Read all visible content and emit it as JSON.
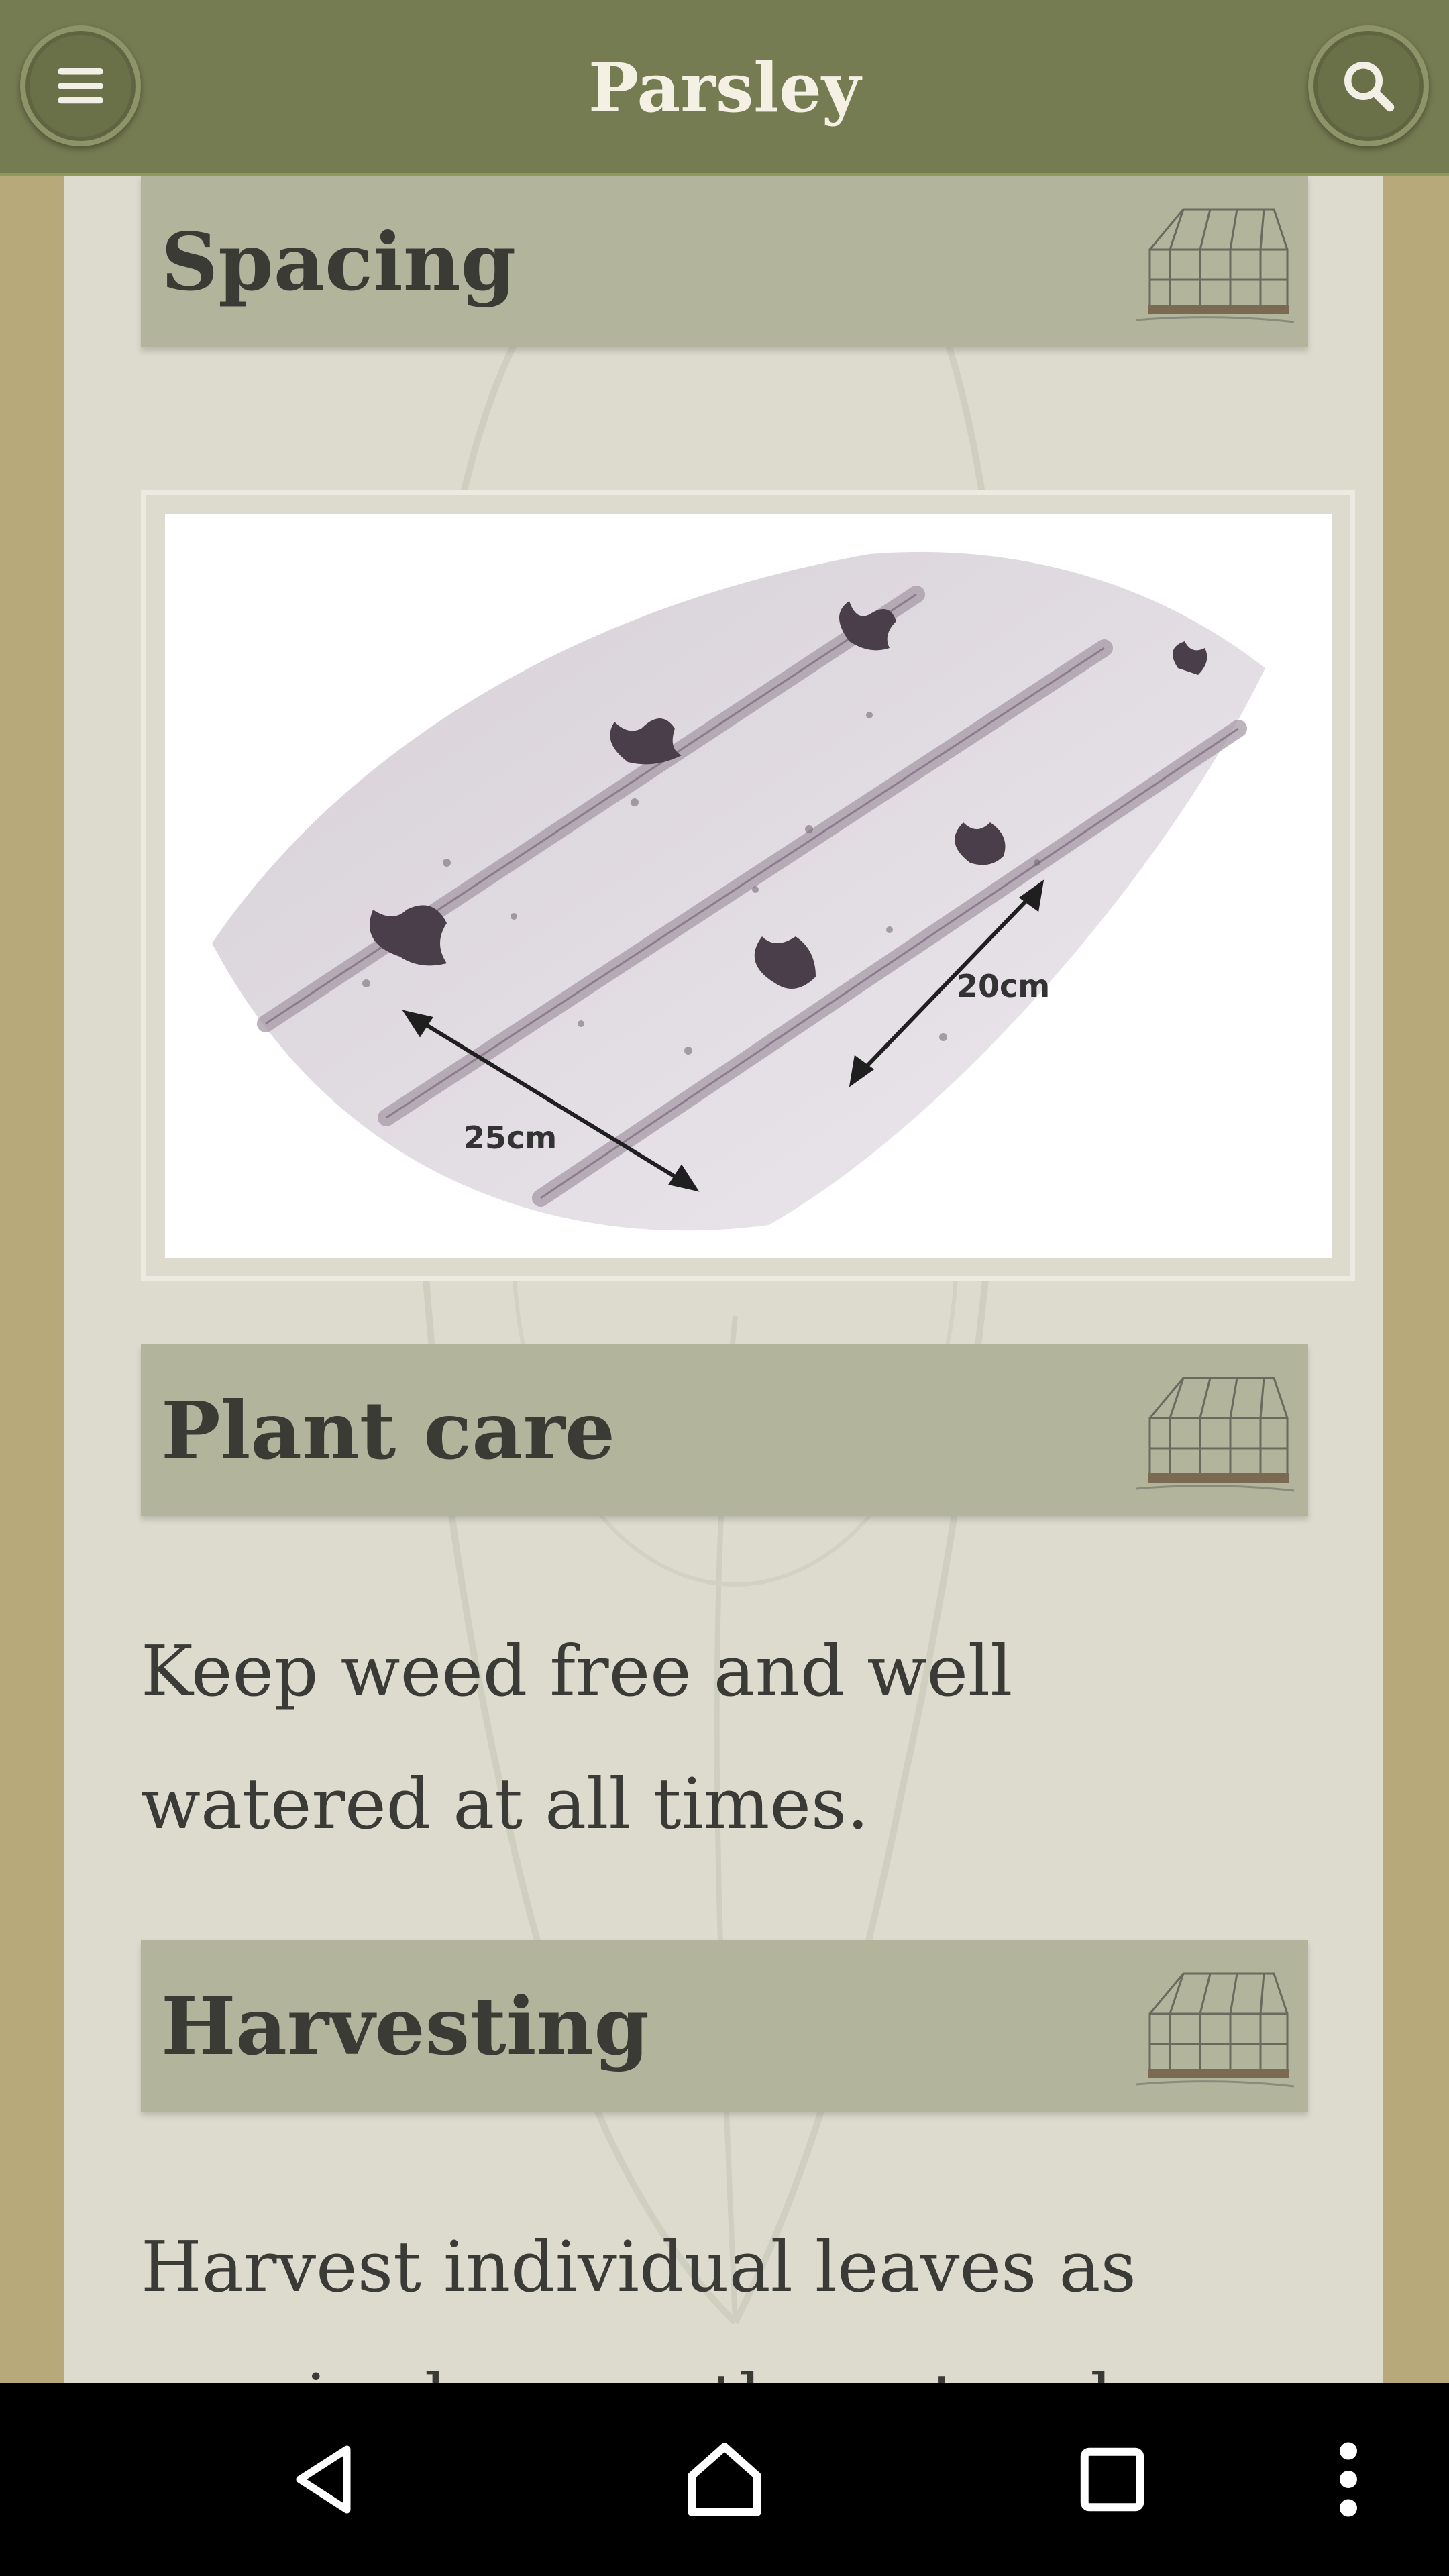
{
  "header": {
    "title": "Parsley"
  },
  "sections": {
    "spacing": {
      "heading": "Spacing"
    },
    "plant_care": {
      "heading": "Plant care",
      "text": "Keep weed free and well watered at all times."
    },
    "harvesting": {
      "heading": "Harvesting",
      "text": "Harvest individual leaves as required or use the cut and come"
    }
  },
  "illustration": {
    "measure_row": "25cm",
    "measure_plant": "20cm"
  },
  "icons": {
    "menu": "menu-icon",
    "search": "search-icon",
    "greenhouse": "greenhouse-icon",
    "back": "back-icon",
    "home": "home-icon",
    "recents": "recents-icon",
    "more": "more-vert-icon"
  },
  "colors": {
    "appbar": "#767c52",
    "panel": "#dcdbcd",
    "section_bar": "#b2b59c",
    "background": "#b8a97a"
  }
}
